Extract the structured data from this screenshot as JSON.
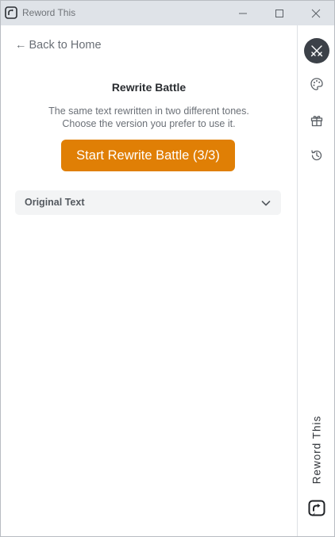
{
  "window": {
    "title": "Reword This"
  },
  "nav": {
    "back_arrow": "←",
    "back_label": "Back to Home"
  },
  "main": {
    "heading": "Rewrite Battle",
    "description_line1": "The same text rewritten in two different tones.",
    "description_line2": "Choose the version you prefer to use it.",
    "battle_button_label": "Start Rewrite Battle (3/3)",
    "accordion_label": "Original Text"
  },
  "rail": {
    "items": [
      {
        "icon": "swords-icon",
        "active": true
      },
      {
        "icon": "palette-icon",
        "active": false
      },
      {
        "icon": "gift-icon",
        "active": false
      },
      {
        "icon": "history-icon",
        "active": false
      }
    ],
    "brand_text": "Reword This"
  },
  "colors": {
    "accent": "#e07f05",
    "titlebar": "#dfe3e8",
    "rail_active": "#3c4148",
    "accordion_bg": "#f3f4f5"
  }
}
